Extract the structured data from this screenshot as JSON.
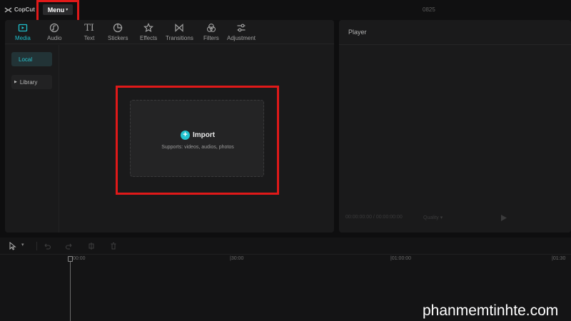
{
  "titlebar": {
    "logo_text": "CopCut",
    "menu_label": "Menu",
    "project_name": "0825"
  },
  "tabs": [
    {
      "label": "Media",
      "icon": "media-icon",
      "active": true
    },
    {
      "label": "Audio",
      "icon": "audio-icon",
      "active": false
    },
    {
      "label": "Text",
      "icon": "text-icon",
      "active": false
    },
    {
      "label": "Stickers",
      "icon": "sticker-icon",
      "active": false
    },
    {
      "label": "Effects",
      "icon": "effects-icon",
      "active": false
    },
    {
      "label": "Transitions",
      "icon": "transitions-icon",
      "active": false
    },
    {
      "label": "Filters",
      "icon": "filters-icon",
      "active": false
    },
    {
      "label": "Adjustment",
      "icon": "adjustment-icon",
      "active": false
    }
  ],
  "sidebar": {
    "items": [
      {
        "label": "Local",
        "active": true
      },
      {
        "label": "Library",
        "active": false
      }
    ]
  },
  "import": {
    "label": "Import",
    "supports": "Supports: videos, audios, photos"
  },
  "player": {
    "title": "Player",
    "time": "00:00:00:00 / 00:00:00:00",
    "quality": "Quality"
  },
  "timeline": {
    "ticks": [
      "00:00",
      "|30:00",
      "|01:00:00",
      "|01:30"
    ]
  },
  "watermark": "phanmemtinhte.com",
  "colors": {
    "accent": "#21c3cf",
    "highlight": "#e01919",
    "panel": "#1a1a1b"
  }
}
